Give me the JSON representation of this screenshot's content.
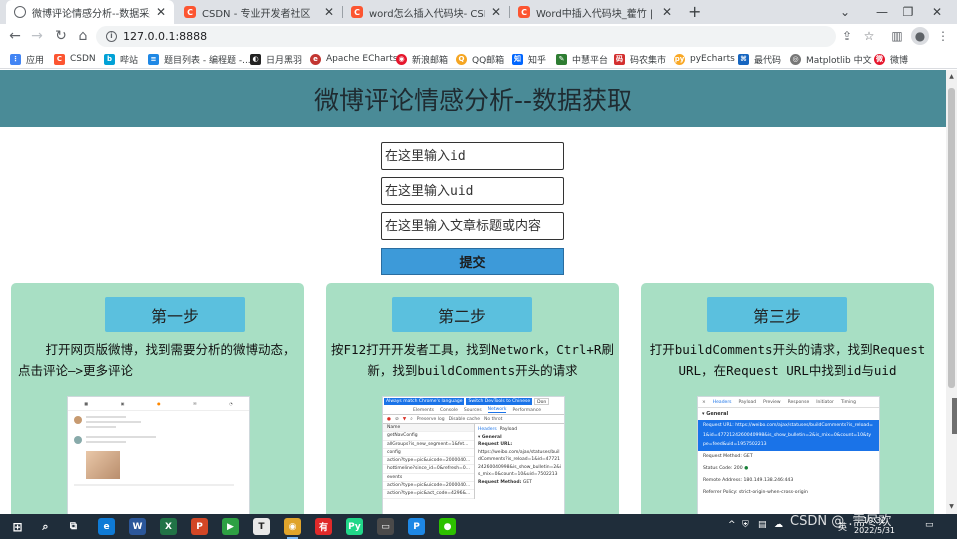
{
  "browser": {
    "tabs": [
      {
        "title": "微博评论情感分析--数据采集",
        "favicon": "globe-icon",
        "active": true
      },
      {
        "title": "CSDN - 专业开发者社区",
        "favicon": "csdn-icon",
        "active": false
      },
      {
        "title": "word怎么插入代码块- CSDN搜索",
        "favicon": "csdn-icon",
        "active": false
      },
      {
        "title": "Word中插入代码块_藿竹 | kevinelee",
        "favicon": "csdn-icon",
        "active": false
      }
    ],
    "new_tab": "+",
    "window_controls": {
      "dropdown": "⌄",
      "minimize": "—",
      "restore": "❐",
      "close": "✕"
    },
    "url": "127.0.0.1:8888",
    "bookmarks": [
      {
        "label": "应用",
        "icon": "apps-grid-icon",
        "color": "#4285f4"
      },
      {
        "label": "CSDN",
        "icon": "csdn-icon",
        "color": "#fc5531"
      },
      {
        "label": "哔站",
        "icon": "bilibili-icon",
        "color": "#00a1d6"
      },
      {
        "label": "题目列表 - 编程题 -...",
        "icon": "list-icon",
        "color": "#1e88e5"
      },
      {
        "label": "日月黑羽",
        "icon": "moon-icon",
        "color": "#222222"
      },
      {
        "label": "Apache ECharts",
        "icon": "echarts-icon",
        "color": "#c23531"
      },
      {
        "label": "新浪邮箱",
        "icon": "sina-icon",
        "color": "#e6162d"
      },
      {
        "label": "QQ邮箱",
        "icon": "qqmail-icon",
        "color": "#f5a623"
      },
      {
        "label": "知乎",
        "icon": "zhihu-icon",
        "color": "#0066ff"
      },
      {
        "label": "中慧平台",
        "icon": "platform-icon",
        "color": "#2e7d32"
      },
      {
        "label": "码农集市",
        "icon": "market-icon",
        "color": "#d32f2f"
      },
      {
        "label": "pyEcharts",
        "icon": "pyecharts-icon",
        "color": "#f9a825"
      },
      {
        "label": "最代码",
        "icon": "code-icon",
        "color": "#1565c0"
      },
      {
        "label": "Matplotlib 中文",
        "icon": "matplotlib-icon",
        "color": "#777777"
      },
      {
        "label": "微博",
        "icon": "weibo-icon",
        "color": "#e6162d"
      }
    ]
  },
  "page": {
    "title": "微博评论情感分析--数据获取",
    "inputs": {
      "id_placeholder": "在这里输入id",
      "uid_placeholder": "在这里输入uid",
      "content_placeholder": "在这里输入文章标题或内容"
    },
    "submit_label": "提交",
    "steps": [
      {
        "title": "第一步",
        "description": "打开网页版微博，找到需要分析的微博动态，点击评论—>更多评论"
      },
      {
        "title": "第二步",
        "description": "按F12打开开发者工具，找到Network，Ctrl+R刷新，找到buildComments开头的请求"
      },
      {
        "title": "第三步",
        "description": "打开buildComments开头的请求，找到Request URL，在Request URL中找到id与uid"
      }
    ],
    "screenshot2": {
      "banner_1": "Always match Chrome's language",
      "banner_2": "Switch DevTools to Chinese",
      "banner_3": "Don",
      "tabs": [
        "Elements",
        "Console",
        "Sources",
        "Network",
        "Performance"
      ],
      "active_tab": "Network",
      "preserve_log": "Preserve log",
      "disable_cache": "Disable cache",
      "throttle": "No throt",
      "col_name": "Name",
      "rows": [
        "getNavConfig",
        "allGroups?is_new_segment=1&fet...",
        "config",
        "action?type=pic&uicode=2000040...",
        "hottimeline?since_id=0&refresh=0...",
        "events",
        "action?type=pic&uicode=2000040...",
        "action?type=pic&act_code=4296&..."
      ],
      "detail_tabs": [
        "Headers",
        "Payload"
      ],
      "general": "▾ General",
      "request_url_label": "Request URL:",
      "request_url": "https://weibo.com/ajax/statuses/buildComments?is_reload=1&id=4772124260040998&is_show_bulletin=2&is_mix=0&count=10&uid=7502213",
      "request_method_label": "Request Method:",
      "request_method": "GET"
    },
    "screenshot3": {
      "tabs": [
        "Headers",
        "Payload",
        "Preview",
        "Response",
        "Initiator",
        "Timing"
      ],
      "close": "×",
      "section": "▾ General",
      "request_url": "Request URL: https://weibo.com/ajax/statuses/buildComments?is_reload=1&id=4772124260040998&is_show_bulletin=2&is_mix=0&count=10&type=feed&uid=1957502213",
      "request_method": "Request Method: GET",
      "status_code": "Status Code: 200",
      "remote_address": "Remote Address: 180.149.138.246:443",
      "referrer_policy": "Referrer Policy: strict-origin-when-cross-origin"
    }
  },
  "taskbar": {
    "clock_time": "10:32",
    "clock_date": "2022/5/31",
    "lang": "英",
    "apps": [
      {
        "name": "edge-icon",
        "color": "#0f7bd6",
        "glyph": "e"
      },
      {
        "name": "word-icon",
        "color": "#2b579a",
        "glyph": "W"
      },
      {
        "name": "excel-icon",
        "color": "#217346",
        "glyph": "X"
      },
      {
        "name": "powerpoint-icon",
        "color": "#d24726",
        "glyph": "P"
      },
      {
        "name": "media-player-icon",
        "color": "#2ea043",
        "glyph": "▶"
      },
      {
        "name": "typora-icon",
        "color": "#e8e8e8",
        "glyph": "T"
      },
      {
        "name": "chrome-icon",
        "color": "#e0a42b",
        "glyph": "◉"
      },
      {
        "name": "youdao-icon",
        "color": "#e02a2a",
        "glyph": "有"
      },
      {
        "name": "pycharm-icon",
        "color": "#21d789",
        "glyph": "Py"
      },
      {
        "name": "terminal-icon",
        "color": "#4a4a4a",
        "glyph": "▭"
      },
      {
        "name": "pdf-icon",
        "color": "#1e88e5",
        "glyph": "P"
      },
      {
        "name": "wechat-icon",
        "color": "#2dc100",
        "glyph": "●"
      }
    ]
  },
  "watermark": "CSDN @ .需尽欢"
}
